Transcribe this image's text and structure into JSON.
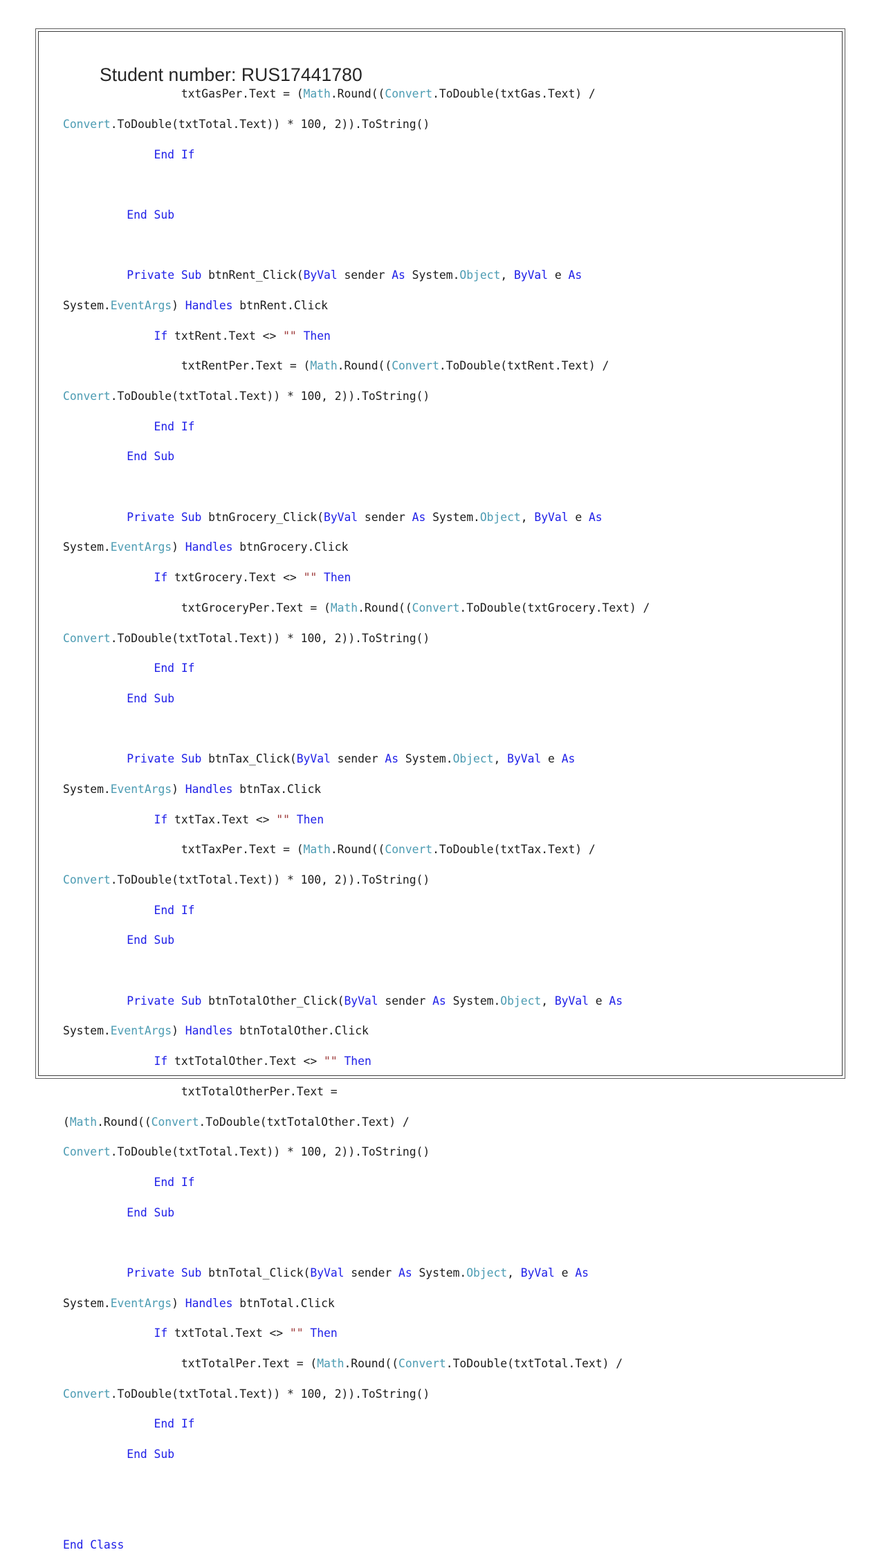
{
  "document": {
    "heading": "Student number: RUS17441780",
    "colors": {
      "keyword": "#2020e8",
      "type": "#4d9cb3",
      "string": "#9d3a3a",
      "plain": "#1c1c1c",
      "page_border": "#3d3d3d",
      "page_background": "#ffffff",
      "heading_color": "#262626"
    },
    "language": "VB.NET",
    "code_lines": [
      {
        "id": "line-1",
        "hang": false,
        "tokens": [
          {
            "t": "            txtGasPer.Text = (",
            "c": "pln"
          },
          {
            "t": "Math",
            "c": "typ"
          },
          {
            "t": ".Round((",
            "c": "pln"
          },
          {
            "t": "Convert",
            "c": "typ"
          },
          {
            "t": ".ToDouble(txtGas.Text) /",
            "c": "pln"
          }
        ]
      },
      {
        "id": "line-2",
        "hang": true,
        "tokens": [
          {
            "t": "Convert",
            "c": "typ"
          },
          {
            "t": ".ToDouble(txtTotal.Text)) * 100, 2)).ToString()",
            "c": "pln"
          }
        ]
      },
      {
        "id": "line-3",
        "hang": false,
        "tokens": [
          {
            "t": "        ",
            "c": "pln"
          },
          {
            "t": "End If",
            "c": "kw"
          }
        ]
      },
      {
        "id": "line-4",
        "hang": false,
        "tokens": []
      },
      {
        "id": "line-5",
        "hang": false,
        "tokens": [
          {
            "t": "    ",
            "c": "pln"
          },
          {
            "t": "End Sub",
            "c": "kw"
          }
        ]
      },
      {
        "id": "line-6",
        "hang": false,
        "tokens": []
      },
      {
        "id": "line-7",
        "hang": false,
        "tokens": [
          {
            "t": "    ",
            "c": "pln"
          },
          {
            "t": "Private Sub",
            "c": "kw"
          },
          {
            "t": " btnRent_Click(",
            "c": "pln"
          },
          {
            "t": "ByVal",
            "c": "kw"
          },
          {
            "t": " sender ",
            "c": "pln"
          },
          {
            "t": "As",
            "c": "kw"
          },
          {
            "t": " System.",
            "c": "pln"
          },
          {
            "t": "Object",
            "c": "typ"
          },
          {
            "t": ", ",
            "c": "pln"
          },
          {
            "t": "ByVal",
            "c": "kw"
          },
          {
            "t": " e ",
            "c": "pln"
          },
          {
            "t": "As",
            "c": "kw"
          }
        ]
      },
      {
        "id": "line-8",
        "hang": true,
        "tokens": [
          {
            "t": "System.",
            "c": "pln"
          },
          {
            "t": "EventArgs",
            "c": "typ"
          },
          {
            "t": ") ",
            "c": "pln"
          },
          {
            "t": "Handles",
            "c": "kw"
          },
          {
            "t": " btnRent.Click",
            "c": "pln"
          }
        ]
      },
      {
        "id": "line-9",
        "hang": false,
        "tokens": [
          {
            "t": "        ",
            "c": "pln"
          },
          {
            "t": "If",
            "c": "kw"
          },
          {
            "t": " txtRent.Text <> ",
            "c": "pln"
          },
          {
            "t": "\"\"",
            "c": "str"
          },
          {
            "t": " ",
            "c": "pln"
          },
          {
            "t": "Then",
            "c": "kw"
          }
        ]
      },
      {
        "id": "line-10",
        "hang": false,
        "tokens": [
          {
            "t": "            txtRentPer.Text = (",
            "c": "pln"
          },
          {
            "t": "Math",
            "c": "typ"
          },
          {
            "t": ".Round((",
            "c": "pln"
          },
          {
            "t": "Convert",
            "c": "typ"
          },
          {
            "t": ".ToDouble(txtRent.Text) /",
            "c": "pln"
          }
        ]
      },
      {
        "id": "line-11",
        "hang": true,
        "tokens": [
          {
            "t": "Convert",
            "c": "typ"
          },
          {
            "t": ".ToDouble(txtTotal.Text)) * 100, 2)).ToString()",
            "c": "pln"
          }
        ]
      },
      {
        "id": "line-12",
        "hang": false,
        "tokens": [
          {
            "t": "        ",
            "c": "pln"
          },
          {
            "t": "End If",
            "c": "kw"
          }
        ]
      },
      {
        "id": "line-13",
        "hang": false,
        "tokens": [
          {
            "t": "    ",
            "c": "pln"
          },
          {
            "t": "End Sub",
            "c": "kw"
          }
        ]
      },
      {
        "id": "line-14",
        "hang": false,
        "tokens": []
      },
      {
        "id": "line-15",
        "hang": false,
        "tokens": [
          {
            "t": "    ",
            "c": "pln"
          },
          {
            "t": "Private Sub",
            "c": "kw"
          },
          {
            "t": " btnGrocery_Click(",
            "c": "pln"
          },
          {
            "t": "ByVal",
            "c": "kw"
          },
          {
            "t": " sender ",
            "c": "pln"
          },
          {
            "t": "As",
            "c": "kw"
          },
          {
            "t": " System.",
            "c": "pln"
          },
          {
            "t": "Object",
            "c": "typ"
          },
          {
            "t": ", ",
            "c": "pln"
          },
          {
            "t": "ByVal",
            "c": "kw"
          },
          {
            "t": " e ",
            "c": "pln"
          },
          {
            "t": "As",
            "c": "kw"
          }
        ]
      },
      {
        "id": "line-16",
        "hang": true,
        "tokens": [
          {
            "t": "System.",
            "c": "pln"
          },
          {
            "t": "EventArgs",
            "c": "typ"
          },
          {
            "t": ") ",
            "c": "pln"
          },
          {
            "t": "Handles",
            "c": "kw"
          },
          {
            "t": " btnGrocery.Click",
            "c": "pln"
          }
        ]
      },
      {
        "id": "line-17",
        "hang": false,
        "tokens": [
          {
            "t": "        ",
            "c": "pln"
          },
          {
            "t": "If",
            "c": "kw"
          },
          {
            "t": " txtGrocery.Text <> ",
            "c": "pln"
          },
          {
            "t": "\"\"",
            "c": "str"
          },
          {
            "t": " ",
            "c": "pln"
          },
          {
            "t": "Then",
            "c": "kw"
          }
        ]
      },
      {
        "id": "line-18",
        "hang": false,
        "tokens": [
          {
            "t": "            txtGroceryPer.Text = (",
            "c": "pln"
          },
          {
            "t": "Math",
            "c": "typ"
          },
          {
            "t": ".Round((",
            "c": "pln"
          },
          {
            "t": "Convert",
            "c": "typ"
          },
          {
            "t": ".ToDouble(txtGrocery.Text) /",
            "c": "pln"
          }
        ]
      },
      {
        "id": "line-19",
        "hang": true,
        "tokens": [
          {
            "t": "Convert",
            "c": "typ"
          },
          {
            "t": ".ToDouble(txtTotal.Text)) * 100, 2)).ToString()",
            "c": "pln"
          }
        ]
      },
      {
        "id": "line-20",
        "hang": false,
        "tokens": [
          {
            "t": "        ",
            "c": "pln"
          },
          {
            "t": "End If",
            "c": "kw"
          }
        ]
      },
      {
        "id": "line-21",
        "hang": false,
        "tokens": [
          {
            "t": "    ",
            "c": "pln"
          },
          {
            "t": "End Sub",
            "c": "kw"
          }
        ]
      },
      {
        "id": "line-22",
        "hang": false,
        "tokens": []
      },
      {
        "id": "line-23",
        "hang": false,
        "tokens": [
          {
            "t": "    ",
            "c": "pln"
          },
          {
            "t": "Private Sub",
            "c": "kw"
          },
          {
            "t": " btnTax_Click(",
            "c": "pln"
          },
          {
            "t": "ByVal",
            "c": "kw"
          },
          {
            "t": " sender ",
            "c": "pln"
          },
          {
            "t": "As",
            "c": "kw"
          },
          {
            "t": " System.",
            "c": "pln"
          },
          {
            "t": "Object",
            "c": "typ"
          },
          {
            "t": ", ",
            "c": "pln"
          },
          {
            "t": "ByVal",
            "c": "kw"
          },
          {
            "t": " e ",
            "c": "pln"
          },
          {
            "t": "As",
            "c": "kw"
          }
        ]
      },
      {
        "id": "line-24",
        "hang": true,
        "tokens": [
          {
            "t": "System.",
            "c": "pln"
          },
          {
            "t": "EventArgs",
            "c": "typ"
          },
          {
            "t": ") ",
            "c": "pln"
          },
          {
            "t": "Handles",
            "c": "kw"
          },
          {
            "t": " btnTax.Click",
            "c": "pln"
          }
        ]
      },
      {
        "id": "line-25",
        "hang": false,
        "tokens": [
          {
            "t": "        ",
            "c": "pln"
          },
          {
            "t": "If",
            "c": "kw"
          },
          {
            "t": " txtTax.Text <> ",
            "c": "pln"
          },
          {
            "t": "\"\"",
            "c": "str"
          },
          {
            "t": " ",
            "c": "pln"
          },
          {
            "t": "Then",
            "c": "kw"
          }
        ]
      },
      {
        "id": "line-26",
        "hang": false,
        "tokens": [
          {
            "t": "            txtTaxPer.Text = (",
            "c": "pln"
          },
          {
            "t": "Math",
            "c": "typ"
          },
          {
            "t": ".Round((",
            "c": "pln"
          },
          {
            "t": "Convert",
            "c": "typ"
          },
          {
            "t": ".ToDouble(txtTax.Text) /",
            "c": "pln"
          }
        ]
      },
      {
        "id": "line-27",
        "hang": true,
        "tokens": [
          {
            "t": "Convert",
            "c": "typ"
          },
          {
            "t": ".ToDouble(txtTotal.Text)) * 100, 2)).ToString()",
            "c": "pln"
          }
        ]
      },
      {
        "id": "line-28",
        "hang": false,
        "tokens": [
          {
            "t": "        ",
            "c": "pln"
          },
          {
            "t": "End If",
            "c": "kw"
          }
        ]
      },
      {
        "id": "line-29",
        "hang": false,
        "tokens": [
          {
            "t": "    ",
            "c": "pln"
          },
          {
            "t": "End Sub",
            "c": "kw"
          }
        ]
      },
      {
        "id": "line-30",
        "hang": false,
        "tokens": []
      },
      {
        "id": "line-31",
        "hang": false,
        "tokens": [
          {
            "t": "    ",
            "c": "pln"
          },
          {
            "t": "Private Sub",
            "c": "kw"
          },
          {
            "t": " btnTotalOther_Click(",
            "c": "pln"
          },
          {
            "t": "ByVal",
            "c": "kw"
          },
          {
            "t": " sender ",
            "c": "pln"
          },
          {
            "t": "As",
            "c": "kw"
          },
          {
            "t": " System.",
            "c": "pln"
          },
          {
            "t": "Object",
            "c": "typ"
          },
          {
            "t": ", ",
            "c": "pln"
          },
          {
            "t": "ByVal",
            "c": "kw"
          },
          {
            "t": " e ",
            "c": "pln"
          },
          {
            "t": "As",
            "c": "kw"
          }
        ]
      },
      {
        "id": "line-32",
        "hang": true,
        "tokens": [
          {
            "t": "System.",
            "c": "pln"
          },
          {
            "t": "EventArgs",
            "c": "typ"
          },
          {
            "t": ") ",
            "c": "pln"
          },
          {
            "t": "Handles",
            "c": "kw"
          },
          {
            "t": " btnTotalOther.Click",
            "c": "pln"
          }
        ]
      },
      {
        "id": "line-33",
        "hang": false,
        "tokens": [
          {
            "t": "        ",
            "c": "pln"
          },
          {
            "t": "If",
            "c": "kw"
          },
          {
            "t": " txtTotalOther.Text <> ",
            "c": "pln"
          },
          {
            "t": "\"\"",
            "c": "str"
          },
          {
            "t": " ",
            "c": "pln"
          },
          {
            "t": "Then",
            "c": "kw"
          }
        ]
      },
      {
        "id": "line-34",
        "hang": false,
        "tokens": [
          {
            "t": "            txtTotalOtherPer.Text =",
            "c": "pln"
          }
        ]
      },
      {
        "id": "line-35",
        "hang": true,
        "tokens": [
          {
            "t": "(",
            "c": "pln"
          },
          {
            "t": "Math",
            "c": "typ"
          },
          {
            "t": ".Round((",
            "c": "pln"
          },
          {
            "t": "Convert",
            "c": "typ"
          },
          {
            "t": ".ToDouble(txtTotalOther.Text) /",
            "c": "pln"
          }
        ]
      },
      {
        "id": "line-36",
        "hang": true,
        "tokens": [
          {
            "t": "Convert",
            "c": "typ"
          },
          {
            "t": ".ToDouble(txtTotal.Text)) * 100, 2)).ToString()",
            "c": "pln"
          }
        ]
      },
      {
        "id": "line-37",
        "hang": false,
        "tokens": [
          {
            "t": "        ",
            "c": "pln"
          },
          {
            "t": "End If",
            "c": "kw"
          }
        ]
      },
      {
        "id": "line-38",
        "hang": false,
        "tokens": [
          {
            "t": "    ",
            "c": "pln"
          },
          {
            "t": "End Sub",
            "c": "kw"
          }
        ]
      },
      {
        "id": "line-39",
        "hang": false,
        "tokens": []
      },
      {
        "id": "line-40",
        "hang": false,
        "tokens": [
          {
            "t": "    ",
            "c": "pln"
          },
          {
            "t": "Private Sub",
            "c": "kw"
          },
          {
            "t": " btnTotal_Click(",
            "c": "pln"
          },
          {
            "t": "ByVal",
            "c": "kw"
          },
          {
            "t": " sender ",
            "c": "pln"
          },
          {
            "t": "As",
            "c": "kw"
          },
          {
            "t": " System.",
            "c": "pln"
          },
          {
            "t": "Object",
            "c": "typ"
          },
          {
            "t": ", ",
            "c": "pln"
          },
          {
            "t": "ByVal",
            "c": "kw"
          },
          {
            "t": " e ",
            "c": "pln"
          },
          {
            "t": "As",
            "c": "kw"
          }
        ]
      },
      {
        "id": "line-41",
        "hang": true,
        "tokens": [
          {
            "t": "System.",
            "c": "pln"
          },
          {
            "t": "EventArgs",
            "c": "typ"
          },
          {
            "t": ") ",
            "c": "pln"
          },
          {
            "t": "Handles",
            "c": "kw"
          },
          {
            "t": " btnTotal.Click",
            "c": "pln"
          }
        ]
      },
      {
        "id": "line-42",
        "hang": false,
        "tokens": [
          {
            "t": "        ",
            "c": "pln"
          },
          {
            "t": "If",
            "c": "kw"
          },
          {
            "t": " txtTotal.Text <> ",
            "c": "pln"
          },
          {
            "t": "\"\"",
            "c": "str"
          },
          {
            "t": " ",
            "c": "pln"
          },
          {
            "t": "Then",
            "c": "kw"
          }
        ]
      },
      {
        "id": "line-43",
        "hang": false,
        "tokens": [
          {
            "t": "            txtTotalPer.Text = (",
            "c": "pln"
          },
          {
            "t": "Math",
            "c": "typ"
          },
          {
            "t": ".Round((",
            "c": "pln"
          },
          {
            "t": "Convert",
            "c": "typ"
          },
          {
            "t": ".ToDouble(txtTotal.Text) /",
            "c": "pln"
          }
        ]
      },
      {
        "id": "line-44",
        "hang": true,
        "tokens": [
          {
            "t": "Convert",
            "c": "typ"
          },
          {
            "t": ".ToDouble(txtTotal.Text)) * 100, 2)).ToString()",
            "c": "pln"
          }
        ]
      },
      {
        "id": "line-45",
        "hang": false,
        "tokens": [
          {
            "t": "        ",
            "c": "pln"
          },
          {
            "t": "End If",
            "c": "kw"
          }
        ]
      },
      {
        "id": "line-46",
        "hang": false,
        "tokens": [
          {
            "t": "    ",
            "c": "pln"
          },
          {
            "t": "End Sub",
            "c": "kw"
          }
        ]
      },
      {
        "id": "line-47",
        "hang": false,
        "tokens": []
      },
      {
        "id": "line-48",
        "hang": false,
        "tokens": []
      },
      {
        "id": "line-49",
        "hang": true,
        "tokens": [
          {
            "t": "End Class",
            "c": "kw"
          }
        ]
      }
    ]
  }
}
